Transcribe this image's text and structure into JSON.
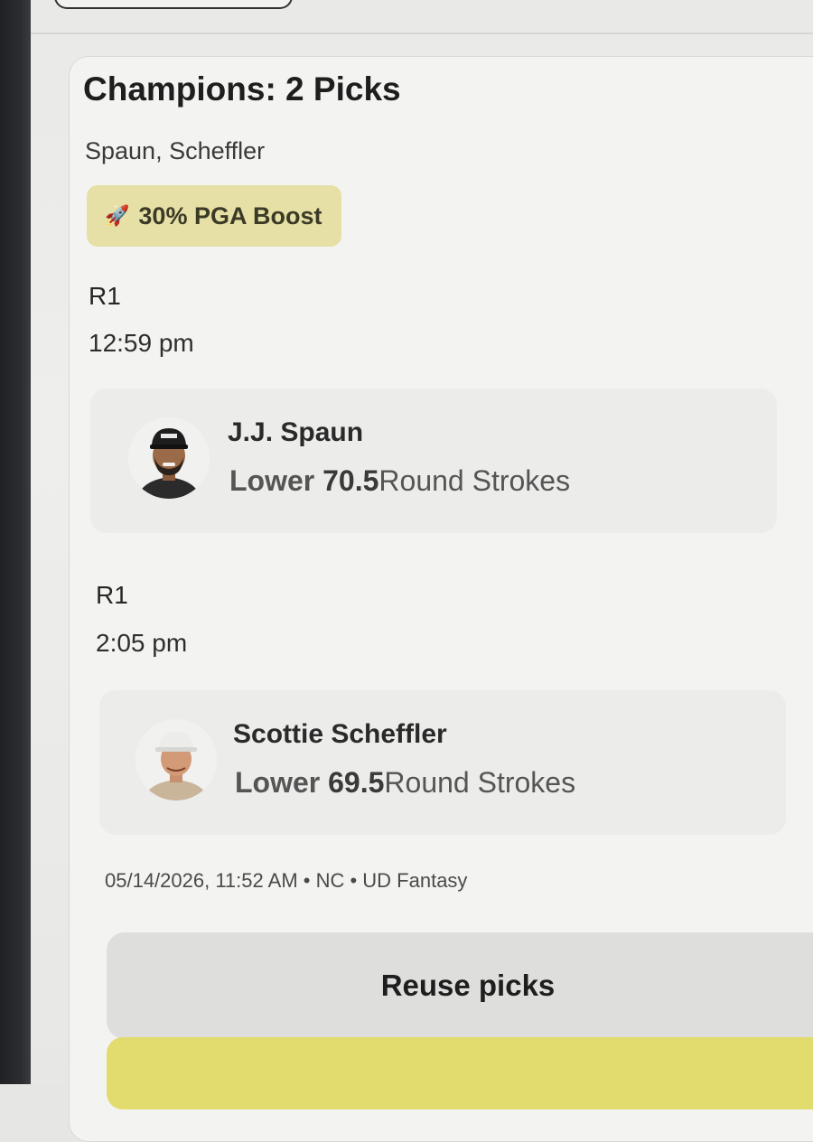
{
  "entry": {
    "title": "Champions: 2 Picks",
    "subtitle": "Spaun, Scheffler",
    "boost": {
      "icon": "rocket-icon",
      "label": "30% PGA Boost",
      "color": "#e6e0a6"
    }
  },
  "picks": [
    {
      "round": "R1",
      "time": "12:59 pm",
      "player": "J.J. Spaun",
      "direction": "Lower",
      "value": "70.5",
      "stat": "Round Strokes"
    },
    {
      "round": "R1",
      "time": "2:05 pm",
      "player": "Scottie Scheffler",
      "direction": "Lower",
      "value": "69.5",
      "stat": "Round Strokes"
    }
  ],
  "footer": {
    "meta": "05/14/2026, 11:52 AM • NC • UD Fantasy",
    "reuse_label": "Reuse picks"
  },
  "colors": {
    "accent_yellow": "#e2dc6e",
    "boost_bg": "#e6e0a6"
  }
}
